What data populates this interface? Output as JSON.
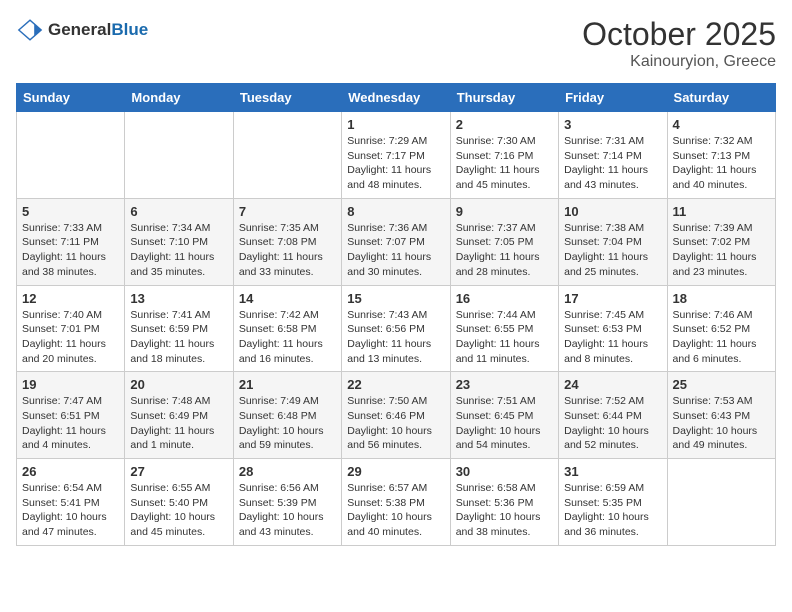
{
  "header": {
    "logo_general": "General",
    "logo_blue": "Blue",
    "month": "October 2025",
    "location": "Kainouryion, Greece"
  },
  "weekdays": [
    "Sunday",
    "Monday",
    "Tuesday",
    "Wednesday",
    "Thursday",
    "Friday",
    "Saturday"
  ],
  "weeks": [
    [
      {
        "day": "",
        "info": ""
      },
      {
        "day": "",
        "info": ""
      },
      {
        "day": "",
        "info": ""
      },
      {
        "day": "1",
        "info": "Sunrise: 7:29 AM\nSunset: 7:17 PM\nDaylight: 11 hours\nand 48 minutes."
      },
      {
        "day": "2",
        "info": "Sunrise: 7:30 AM\nSunset: 7:16 PM\nDaylight: 11 hours\nand 45 minutes."
      },
      {
        "day": "3",
        "info": "Sunrise: 7:31 AM\nSunset: 7:14 PM\nDaylight: 11 hours\nand 43 minutes."
      },
      {
        "day": "4",
        "info": "Sunrise: 7:32 AM\nSunset: 7:13 PM\nDaylight: 11 hours\nand 40 minutes."
      }
    ],
    [
      {
        "day": "5",
        "info": "Sunrise: 7:33 AM\nSunset: 7:11 PM\nDaylight: 11 hours\nand 38 minutes."
      },
      {
        "day": "6",
        "info": "Sunrise: 7:34 AM\nSunset: 7:10 PM\nDaylight: 11 hours\nand 35 minutes."
      },
      {
        "day": "7",
        "info": "Sunrise: 7:35 AM\nSunset: 7:08 PM\nDaylight: 11 hours\nand 33 minutes."
      },
      {
        "day": "8",
        "info": "Sunrise: 7:36 AM\nSunset: 7:07 PM\nDaylight: 11 hours\nand 30 minutes."
      },
      {
        "day": "9",
        "info": "Sunrise: 7:37 AM\nSunset: 7:05 PM\nDaylight: 11 hours\nand 28 minutes."
      },
      {
        "day": "10",
        "info": "Sunrise: 7:38 AM\nSunset: 7:04 PM\nDaylight: 11 hours\nand 25 minutes."
      },
      {
        "day": "11",
        "info": "Sunrise: 7:39 AM\nSunset: 7:02 PM\nDaylight: 11 hours\nand 23 minutes."
      }
    ],
    [
      {
        "day": "12",
        "info": "Sunrise: 7:40 AM\nSunset: 7:01 PM\nDaylight: 11 hours\nand 20 minutes."
      },
      {
        "day": "13",
        "info": "Sunrise: 7:41 AM\nSunset: 6:59 PM\nDaylight: 11 hours\nand 18 minutes."
      },
      {
        "day": "14",
        "info": "Sunrise: 7:42 AM\nSunset: 6:58 PM\nDaylight: 11 hours\nand 16 minutes."
      },
      {
        "day": "15",
        "info": "Sunrise: 7:43 AM\nSunset: 6:56 PM\nDaylight: 11 hours\nand 13 minutes."
      },
      {
        "day": "16",
        "info": "Sunrise: 7:44 AM\nSunset: 6:55 PM\nDaylight: 11 hours\nand 11 minutes."
      },
      {
        "day": "17",
        "info": "Sunrise: 7:45 AM\nSunset: 6:53 PM\nDaylight: 11 hours\nand 8 minutes."
      },
      {
        "day": "18",
        "info": "Sunrise: 7:46 AM\nSunset: 6:52 PM\nDaylight: 11 hours\nand 6 minutes."
      }
    ],
    [
      {
        "day": "19",
        "info": "Sunrise: 7:47 AM\nSunset: 6:51 PM\nDaylight: 11 hours\nand 4 minutes."
      },
      {
        "day": "20",
        "info": "Sunrise: 7:48 AM\nSunset: 6:49 PM\nDaylight: 11 hours\nand 1 minute."
      },
      {
        "day": "21",
        "info": "Sunrise: 7:49 AM\nSunset: 6:48 PM\nDaylight: 10 hours\nand 59 minutes."
      },
      {
        "day": "22",
        "info": "Sunrise: 7:50 AM\nSunset: 6:46 PM\nDaylight: 10 hours\nand 56 minutes."
      },
      {
        "day": "23",
        "info": "Sunrise: 7:51 AM\nSunset: 6:45 PM\nDaylight: 10 hours\nand 54 minutes."
      },
      {
        "day": "24",
        "info": "Sunrise: 7:52 AM\nSunset: 6:44 PM\nDaylight: 10 hours\nand 52 minutes."
      },
      {
        "day": "25",
        "info": "Sunrise: 7:53 AM\nSunset: 6:43 PM\nDaylight: 10 hours\nand 49 minutes."
      }
    ],
    [
      {
        "day": "26",
        "info": "Sunrise: 6:54 AM\nSunset: 5:41 PM\nDaylight: 10 hours\nand 47 minutes."
      },
      {
        "day": "27",
        "info": "Sunrise: 6:55 AM\nSunset: 5:40 PM\nDaylight: 10 hours\nand 45 minutes."
      },
      {
        "day": "28",
        "info": "Sunrise: 6:56 AM\nSunset: 5:39 PM\nDaylight: 10 hours\nand 43 minutes."
      },
      {
        "day": "29",
        "info": "Sunrise: 6:57 AM\nSunset: 5:38 PM\nDaylight: 10 hours\nand 40 minutes."
      },
      {
        "day": "30",
        "info": "Sunrise: 6:58 AM\nSunset: 5:36 PM\nDaylight: 10 hours\nand 38 minutes."
      },
      {
        "day": "31",
        "info": "Sunrise: 6:59 AM\nSunset: 5:35 PM\nDaylight: 10 hours\nand 36 minutes."
      },
      {
        "day": "",
        "info": ""
      }
    ]
  ]
}
